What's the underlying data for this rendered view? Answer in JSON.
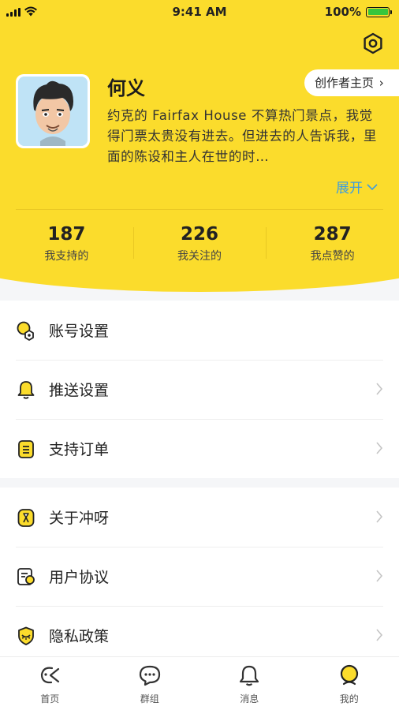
{
  "status_bar": {
    "time": "9:41 AM",
    "battery": "100%"
  },
  "profile": {
    "name": "何义",
    "creator_button": "创作者主页",
    "bio": "约克的 Fairfax House 不算热门景点，我觉得门票太贵没有进去。但进去的人告诉我，里面的陈设和主人在世的时…",
    "expand_label": "展开"
  },
  "stats": [
    {
      "value": "187",
      "label": "我支持的"
    },
    {
      "value": "226",
      "label": "我关注的"
    },
    {
      "value": "287",
      "label": "我点赞的"
    }
  ],
  "menu_group_1": [
    {
      "label": "账号设置",
      "icon": "account-settings-icon"
    },
    {
      "label": "推送设置",
      "icon": "bell-icon"
    },
    {
      "label": "支持订单",
      "icon": "order-list-icon"
    }
  ],
  "menu_group_2": [
    {
      "label": "关于冲呀",
      "icon": "about-icon"
    },
    {
      "label": "用户协议",
      "icon": "agreement-icon"
    },
    {
      "label": "隐私政策",
      "icon": "privacy-shield-icon"
    }
  ],
  "tabbar": [
    {
      "label": "首页",
      "icon": "home-icon"
    },
    {
      "label": "群组",
      "icon": "chat-bubble-icon"
    },
    {
      "label": "消息",
      "icon": "bell-icon"
    },
    {
      "label": "我的",
      "icon": "profile-icon"
    }
  ],
  "colors": {
    "brand_yellow": "#fbdc2c",
    "link_blue": "#3d9de0"
  }
}
